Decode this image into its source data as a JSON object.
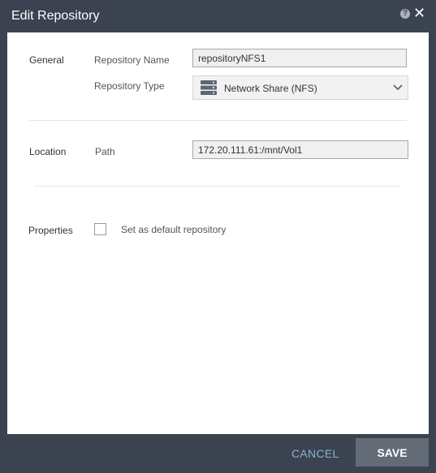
{
  "dialog": {
    "title": "Edit Repository",
    "help_icon": "question-mark-icon",
    "close_icon": "close-x-icon"
  },
  "general": {
    "section_label": "General",
    "repository_name_label": "Repository Name",
    "repository_name_value": "repositoryNFS1",
    "repository_type_label": "Repository Type",
    "repository_type_value": "Network Share (NFS)",
    "repository_type_icon": "storage-server-icon"
  },
  "location": {
    "section_label": "Location",
    "path_label": "Path",
    "path_value": "172.20.111.61:/mnt/Vol1"
  },
  "properties": {
    "section_label": "Properties",
    "default_checkbox_label": "Set as default repository",
    "default_checked": false
  },
  "footer": {
    "cancel_label": "CANCEL",
    "save_label": "SAVE"
  },
  "colors": {
    "frame": "#3b4350",
    "panel": "#ffffff",
    "save_button": "#636b76",
    "cancel_text": "#8ab0cc"
  }
}
